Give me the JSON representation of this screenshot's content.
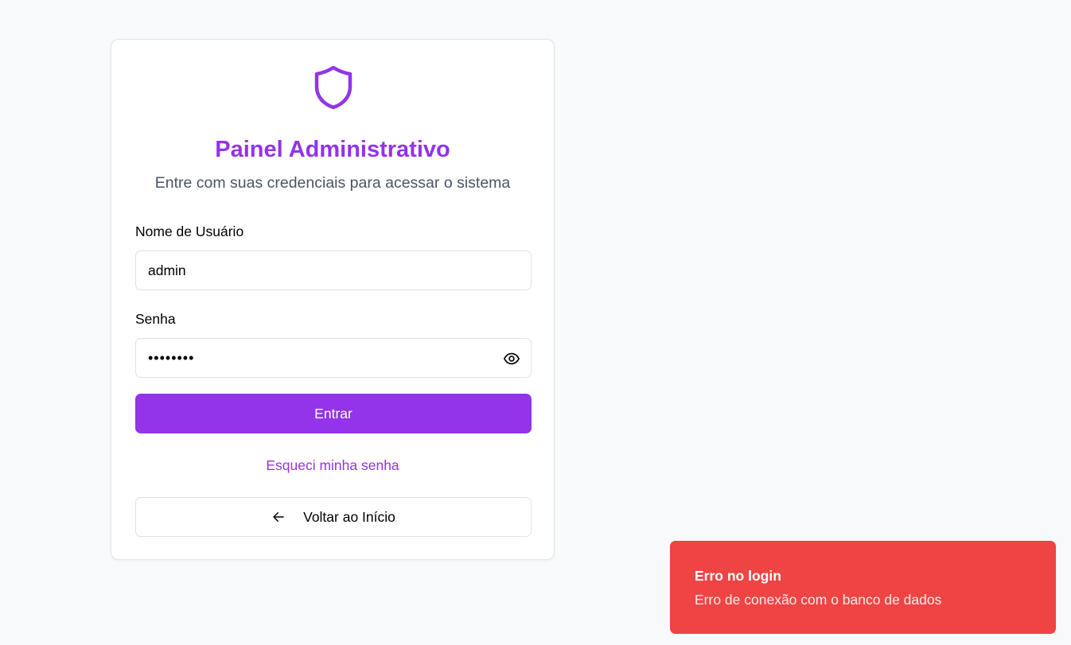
{
  "colors": {
    "accent": "#9333ea",
    "error": "#ef4444",
    "background": "#f8f9fb"
  },
  "login": {
    "icon": "shield-icon",
    "title": "Painel Administrativo",
    "subtitle": "Entre com suas credenciais para acessar o sistema",
    "username_label": "Nome de Usuário",
    "username_value": "admin",
    "password_label": "Senha",
    "password_value": "••••••••",
    "show_password_icon": "eye-icon",
    "submit_label": "Entrar",
    "forgot_password_label": "Esqueci minha senha",
    "back_icon": "arrow-left-icon",
    "back_label": "Voltar ao Início"
  },
  "toast": {
    "title": "Erro no login",
    "message": "Erro de conexão com o banco de dados"
  }
}
